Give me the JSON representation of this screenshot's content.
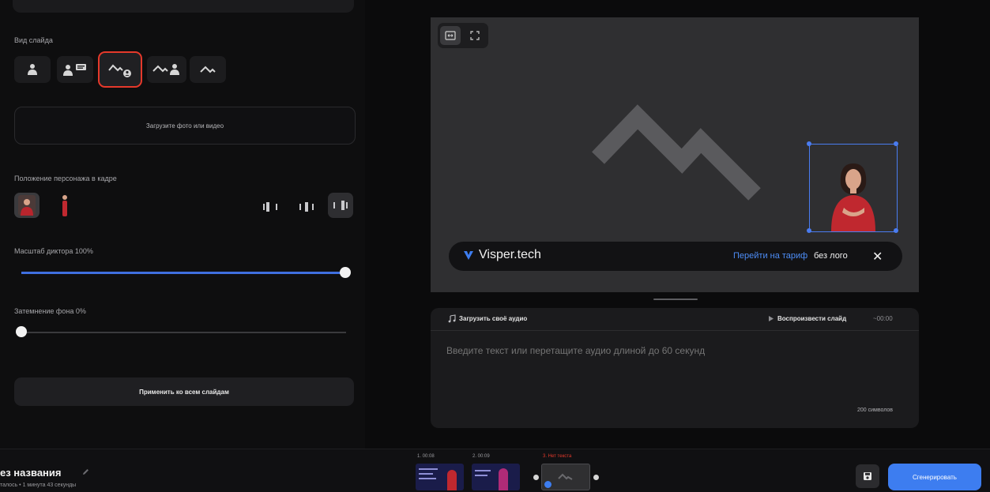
{
  "left_panel": {
    "slide_type_label": "Вид слайда",
    "upload_media_label": "Загрузите фото или видео",
    "presenter_position_label": "Положение персонажа в кадре",
    "presenter_scale_label": "Масштаб диктора 100%",
    "presenter_scale_value": 1.0,
    "background_dim_label": "Затемнение фона 0%",
    "background_dim_value": 0.0,
    "apply_all_label": "Применить ко всем слайдам",
    "selected_slide_type": "background-with-small-presenter"
  },
  "preview": {
    "watermark_brand": "Visper.tech",
    "watermark_link": "Перейти на тариф",
    "watermark_suffix": "без лого",
    "close_symbol": "✕"
  },
  "script": {
    "upload_audio_label": "Загрузить своё аудио",
    "play_slide_label": "Воспроизвести слайд",
    "play_time": "~00:00",
    "placeholder": "Введите текст или перетащите аудио длиной до 60 секунд",
    "char_count": "200 символов"
  },
  "bottom_bar": {
    "project_title": "ез названия",
    "project_subtitle": "талось • 1 минута 43 секунды",
    "slides": [
      {
        "label": "1. 00:08"
      },
      {
        "label": "2. 00:09"
      },
      {
        "label": "3. Нет текста"
      }
    ],
    "generate_label": "Сгенерировать"
  },
  "colors": {
    "accent": "#3d7df0",
    "highlight": "#e5392b",
    "background": "#0b0b0c"
  }
}
